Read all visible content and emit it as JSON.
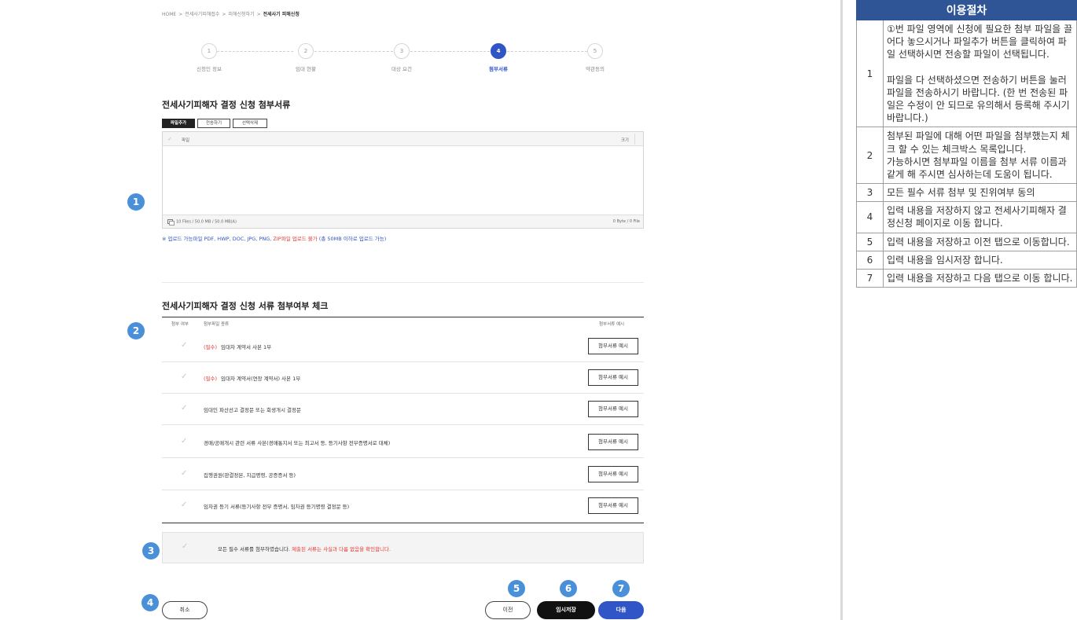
{
  "breadcrumb": [
    "HOME",
    "전세사기피해접수",
    "피해신청하기",
    "전세사기 피해신청"
  ],
  "stepper": {
    "steps": [
      {
        "number": "1",
        "label": "신청인 정보"
      },
      {
        "number": "2",
        "label": "임대 현황"
      },
      {
        "number": "3",
        "label": "대상 요건"
      },
      {
        "number": "4",
        "label": "첨부서류"
      },
      {
        "number": "5",
        "label": "약관동의"
      }
    ],
    "active_step": 4
  },
  "upload_section": {
    "title": "전세사기피해자 결정 신청 첨부서류",
    "buttons": [
      "파일추가",
      "전송하기",
      "선택삭제"
    ],
    "columns": {
      "file": "파일",
      "size": "크기"
    },
    "footer_left": "10 Files / 50.0 MB / 50.0 MB(A)",
    "footer_right": "0 Byte / 0 File",
    "note_main": "※ 업로드 가능파일 PDF, HWP, DOC, JPG, PNG, ",
    "note_zip": "ZIP파일 업로드 불가",
    "note_tail": " (총 50MB 이하로 업로드 가능)"
  },
  "checklist_section": {
    "title": "전세사기피해자 결정 신청 서류 첨부여부 체크",
    "columns": {
      "attached": "첨부 여부",
      "type": "첨부파일 종류",
      "example": "첨부서류 예시"
    },
    "required_tag": "(필수)",
    "example_button": "첨부서류 예시",
    "rows": [
      {
        "required": true,
        "text": "임대차 계약서 사본 1부"
      },
      {
        "required": true,
        "text": "임대차 계약서(연장 계약서) 사본 1부"
      },
      {
        "required": false,
        "text": "임대인 파산선고 결정문 또는 회생개시 결정문"
      },
      {
        "required": false,
        "text": "경매/공매개시 관련 서류 사본(경매통지서 또는 최고서 등, 등기사항 전부증명서로 대체)"
      },
      {
        "required": false,
        "text": "집행권원(판결정본, 지급명령, 공증증서 등)"
      },
      {
        "required": false,
        "text": "임차권 등기 서류(등기사항 전부 증명서, 임차권 등기명령 결정문 등)"
      }
    ],
    "agree_text": "모든 필수 서류를 첨부하였습니다. ",
    "agree_red": "제출된 서류는 사실과 다름 없음을 확인합니다."
  },
  "actions": {
    "cancel": "취소",
    "prev": "이전",
    "temp_save": "임시저장",
    "next": "다음"
  },
  "badges": [
    "1",
    "2",
    "3",
    "4",
    "5",
    "6",
    "7"
  ],
  "guide": {
    "title": "이용절차",
    "rows": [
      {
        "num": "1",
        "paras": [
          "①번 파일 영역에 신청에 필요한 첨부 파일을 끌어다 놓으시거나 파일추가 버튼을 클릭하여 파일 선택하시면 전송할 파일이 선택됩니다.",
          "파일을 다 선택하셨으면 전송하기 버튼을 눌러 파일을 전송하시기 바랍니다. (한 번 전송된 파일은 수정이 안 되므로 유의해서 등록해 주시기 바랍니다.)"
        ]
      },
      {
        "num": "2",
        "paras": [
          "첨부된 파일에 대해 어떤 파일을 첨부했는지 체크 할 수 있는 체크박스 목록입니다.",
          "가능하시면 첨부파일 이름을 첨부 서류 이름과 같게 해 주시면 심사하는데 도움이 됩니다."
        ]
      },
      {
        "num": "3",
        "paras": [
          "모든 필수 서류 첨부 및 진위여부 동의"
        ]
      },
      {
        "num": "4",
        "paras": [
          "입력 내용을 저장하지 않고 전세사기피해자 결정신청 페이지로 이동 합니다."
        ]
      },
      {
        "num": "5",
        "paras": [
          "입력 내용을 저장하고 이전 탭으로 이동합니다."
        ]
      },
      {
        "num": "6",
        "paras": [
          "입력 내용을 임시저장 합니다."
        ]
      },
      {
        "num": "7",
        "paras": [
          "입력 내용을 저장하고 다음 탭으로 이동 합니다."
        ]
      }
    ]
  },
  "colors": {
    "accent": "#2f55c7",
    "badge": "#4a90d9",
    "guide_header": "#2f5597",
    "required_red": "#e53935"
  }
}
